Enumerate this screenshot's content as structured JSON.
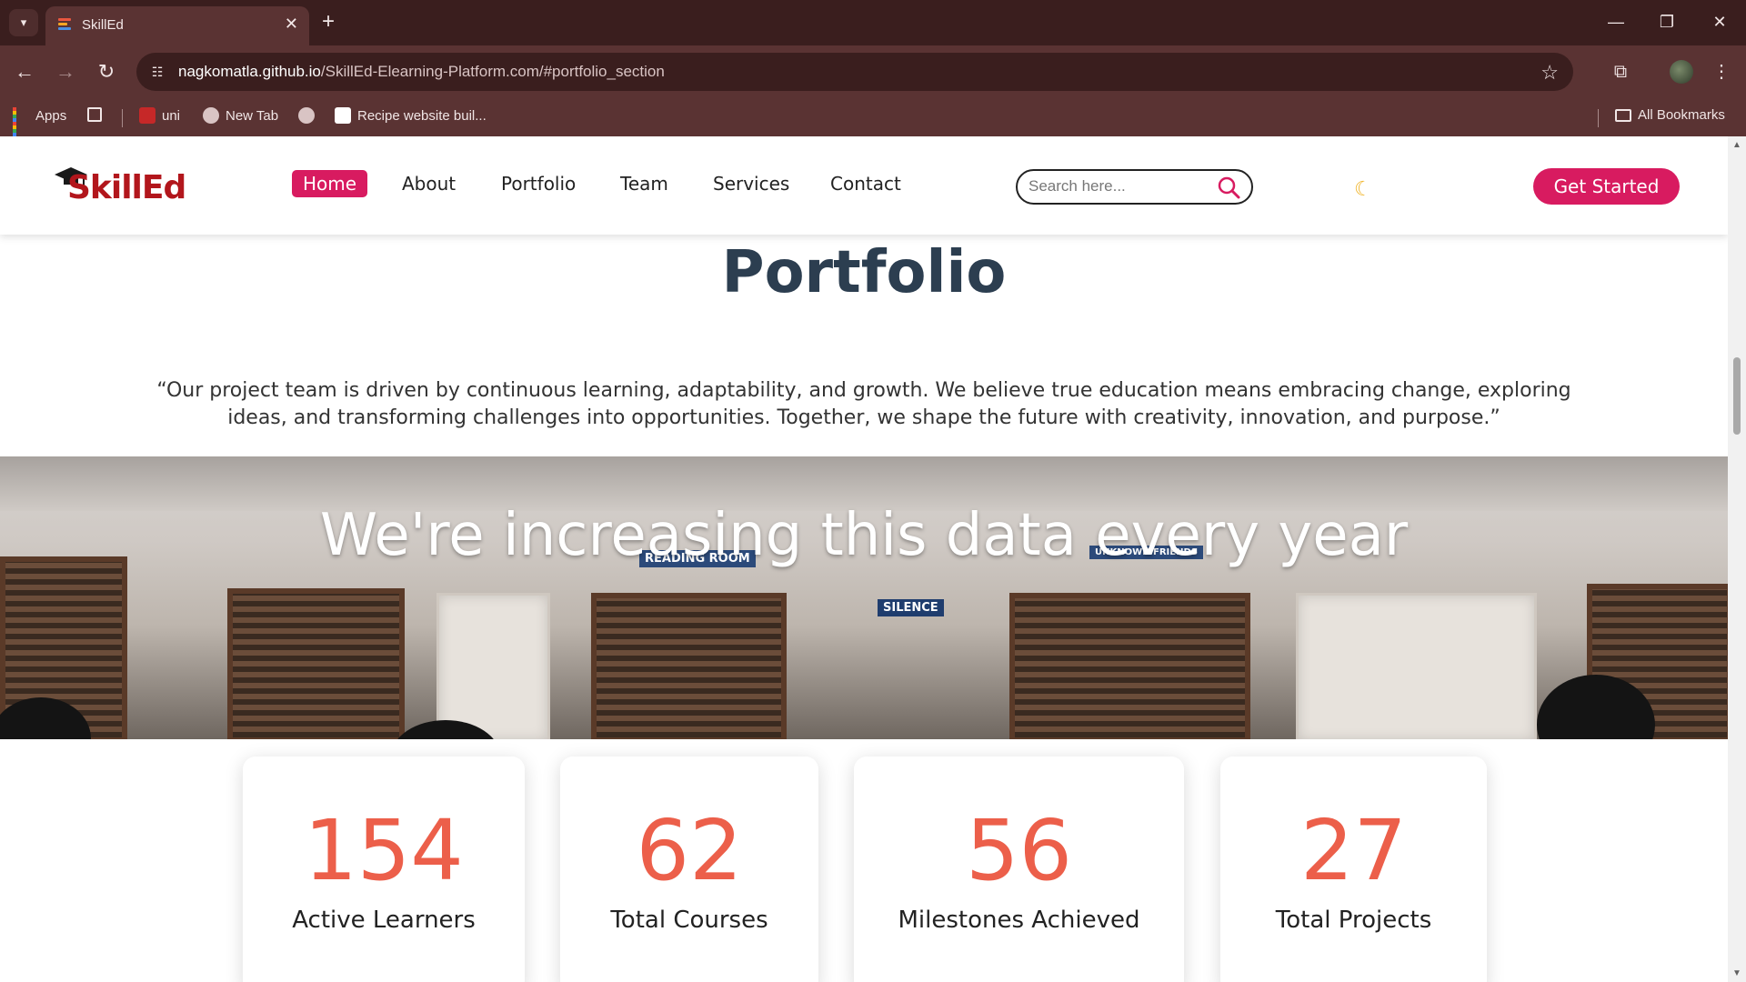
{
  "browser": {
    "tab": {
      "title": "SkillEd"
    },
    "url": {
      "host": "nagkomatla.github.io",
      "path": "/SkillEd-Elearning-Platform.com/#portfolio_section"
    },
    "bookmarks": [
      {
        "label": "Apps"
      },
      {
        "label": "uni"
      },
      {
        "label": "New Tab"
      },
      {
        "label": "Recipe website buil..."
      }
    ],
    "all_bookmarks_label": "All Bookmarks",
    "theme_color": "#5a3333"
  },
  "site": {
    "logo": {
      "text_a": "Skill",
      "text_b": "Ed"
    },
    "nav": [
      {
        "label": "Home",
        "active": true
      },
      {
        "label": "About"
      },
      {
        "label": "Portfolio"
      },
      {
        "label": "Team"
      },
      {
        "label": "Services"
      },
      {
        "label": "Contact"
      }
    ],
    "search": {
      "placeholder": "Search here..."
    },
    "cta_label": "Get Started",
    "accent_color": "#d81b60"
  },
  "portfolio": {
    "title": "Portfolio",
    "quote": "“Our project team is driven by continuous learning, adaptability, and growth. We believe true education means embracing change, exploring ideas, and transforming challenges into opportunities. Together, we shape the future with creativity, innovation, and purpose.”",
    "banner": {
      "heading": "We're increasing this data every year",
      "signs": [
        "READING ROOM",
        "SILENCE",
        "UNKNOWN FRIENDS"
      ]
    },
    "stats": [
      {
        "value": "154",
        "label": "Active Learners"
      },
      {
        "value": "62",
        "label": "Total Courses"
      },
      {
        "value": "56",
        "label": "Milestones Achieved"
      },
      {
        "value": "27",
        "label": "Total Projects"
      }
    ],
    "stat_color": "#ec5f4a"
  }
}
